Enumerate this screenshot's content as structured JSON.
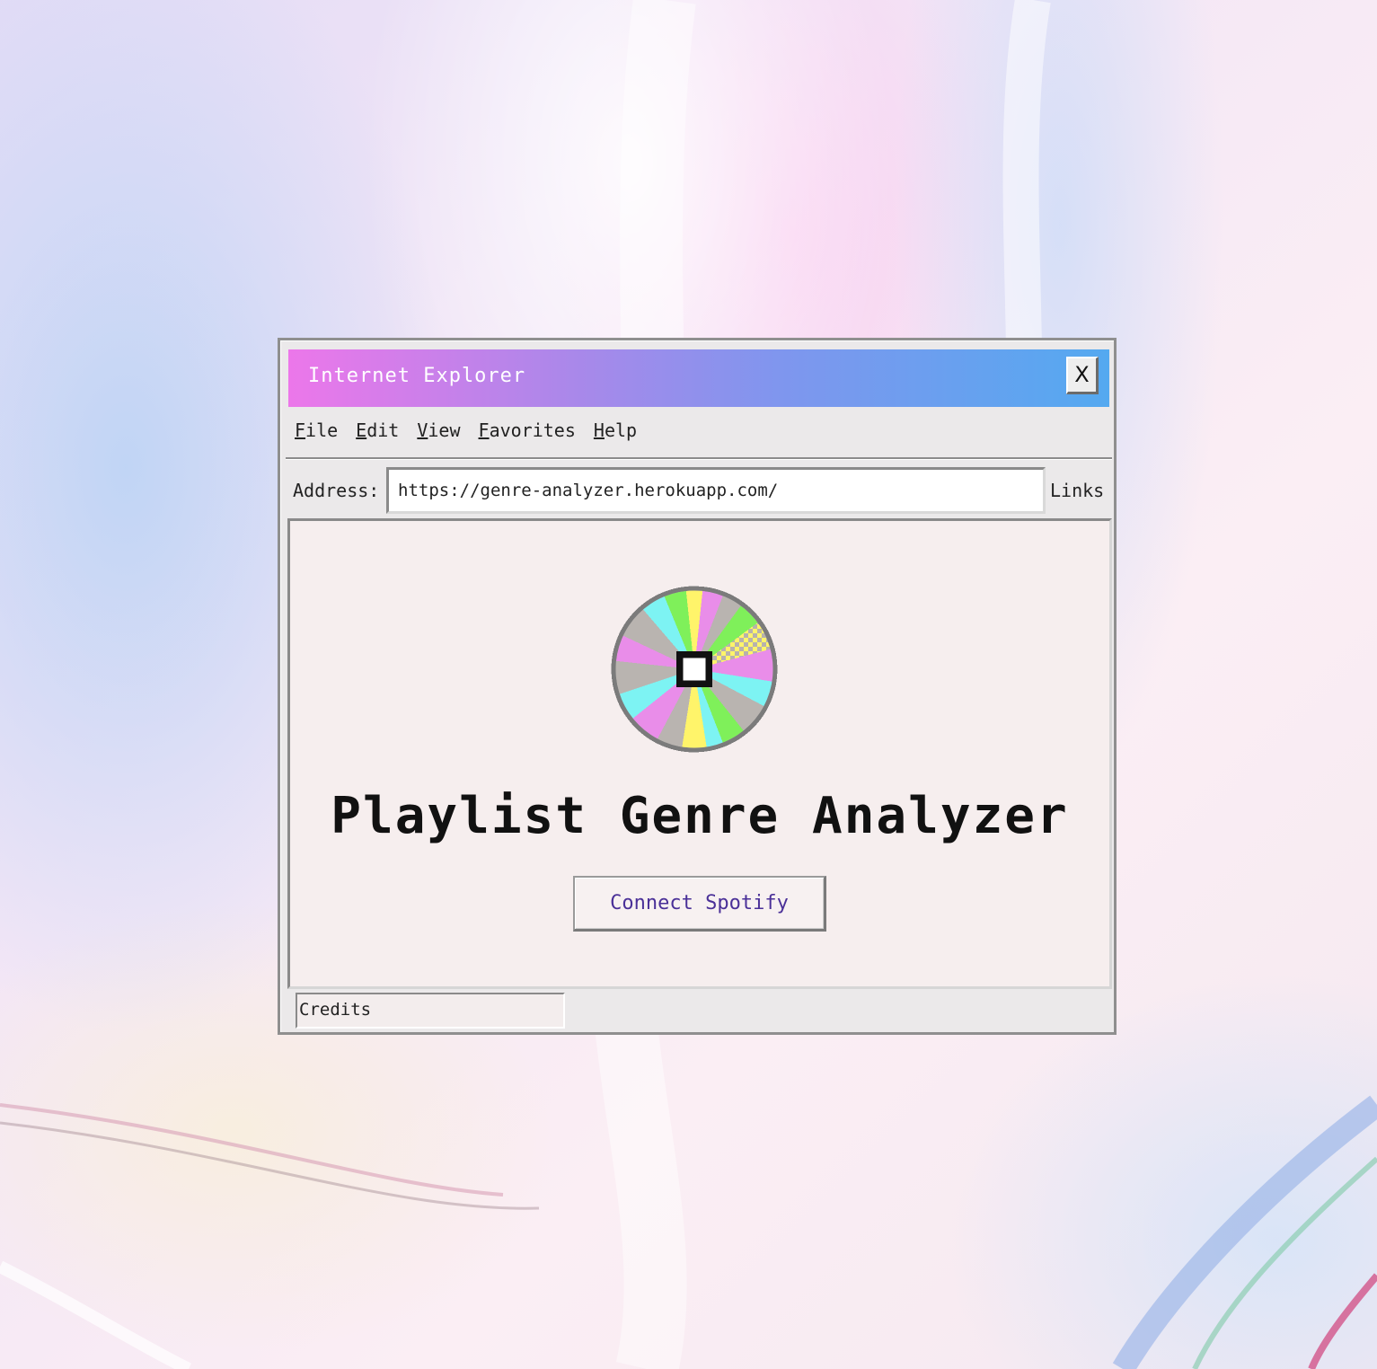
{
  "window": {
    "title": "Internet Explorer",
    "close_label": "X"
  },
  "menu": {
    "items": [
      {
        "accel": "F",
        "rest": "ile"
      },
      {
        "accel": "E",
        "rest": "dit"
      },
      {
        "accel": "V",
        "rest": "iew"
      },
      {
        "accel": "F",
        "rest": "avorites"
      },
      {
        "accel": "H",
        "rest": "elp"
      }
    ]
  },
  "address_bar": {
    "label": "Address:",
    "value": "https://genre-analyzer.herokuapp.com/",
    "links_label": "Links"
  },
  "page": {
    "icon": "pixel-cd-icon",
    "title": "Playlist Genre Analyzer",
    "connect_button": "Connect Spotify"
  },
  "status_bar": {
    "credits_label": "Credits"
  },
  "colors": {
    "titlebar_start": "#ec77ea",
    "titlebar_end": "#54a9f0",
    "button_text": "#4a3098",
    "content_bg": "#f6eeee"
  }
}
